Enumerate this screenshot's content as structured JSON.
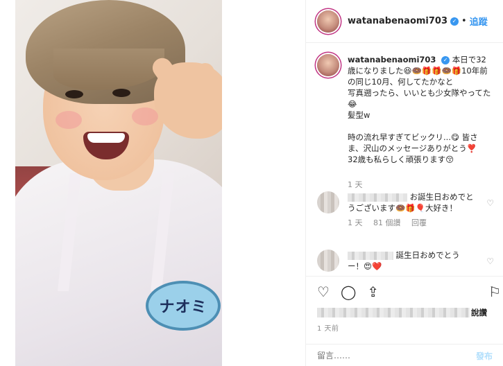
{
  "photo": {
    "nametag": "ナオミ"
  },
  "header": {
    "username": "watanabenaomi703",
    "separator": "•",
    "follow_label": "追蹤"
  },
  "caption": {
    "username": "watanabenaomi703",
    "text": "本日で32歳になりました😆🍩🎁🎁🍩🎁10年前の同じ10月、何してたかなと\n写真遡ったら、いいとも少女隊やってた😂\n髪型w\n\n時の流れ早すぎてビックリ...😋 皆さま、沢山のメッセージありがとう❣️\n32歳も私らしく頑張ります😚",
    "time": "1 天"
  },
  "comments": [
    {
      "text": "お誕生日おめでとうございます🍩🎁🎈大好き！",
      "time": "1 天",
      "likes": "81 個讚",
      "reply": "回覆"
    },
    {
      "text": "誕生日おめでとう ー！😍❤️"
    }
  ],
  "actions": {
    "likes_suffix": "說讚",
    "timestamp": "1 天前"
  },
  "composer": {
    "placeholder": "留言……",
    "post_label": "發布"
  },
  "icons": {
    "verified": "verified-badge-icon",
    "heart": "heart-icon",
    "comment": "comment-icon",
    "share": "share-icon",
    "bookmark": "bookmark-icon"
  }
}
